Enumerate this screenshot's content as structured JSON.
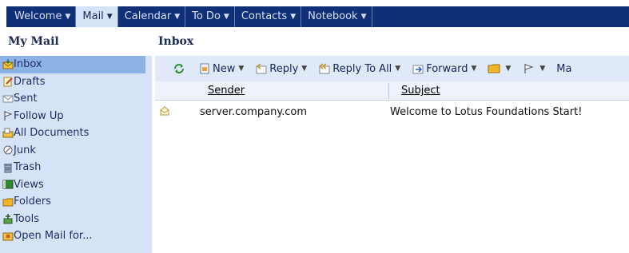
{
  "tabs": [
    {
      "label": "Welcome",
      "active": false
    },
    {
      "label": "Mail",
      "active": true
    },
    {
      "label": "Calendar",
      "active": false
    },
    {
      "label": "To Do",
      "active": false
    },
    {
      "label": "Contacts",
      "active": false
    },
    {
      "label": "Notebook",
      "active": false
    }
  ],
  "sidebar": {
    "title": "My Mail",
    "items": [
      {
        "label": "Inbox",
        "icon": "inbox-icon",
        "selected": true
      },
      {
        "label": "Drafts",
        "icon": "drafts-icon"
      },
      {
        "label": "Sent",
        "icon": "sent-icon"
      },
      {
        "label": "Follow Up",
        "icon": "follow-up-flag-icon"
      },
      {
        "label": "All Documents",
        "icon": "all-documents-icon"
      },
      {
        "label": "Junk",
        "icon": "junk-icon"
      },
      {
        "label": "Trash",
        "icon": "trash-icon"
      },
      {
        "label": "Views",
        "icon": "views-icon"
      },
      {
        "label": "Folders",
        "icon": "folders-icon"
      },
      {
        "label": "Tools",
        "icon": "tools-icon"
      },
      {
        "label": "Open Mail for...",
        "icon": "open-mail-icon"
      }
    ]
  },
  "main": {
    "title": "Inbox",
    "toolbar": {
      "refresh_icon": "refresh-icon",
      "new_label": "New",
      "reply_label": "Reply",
      "reply_all_label": "Reply To All",
      "forward_label": "Forward",
      "overflow_label": "Ma"
    },
    "columns": {
      "sender": "Sender",
      "subject": "Subject"
    },
    "rows": [
      {
        "sender": "server.company.com",
        "subject": "Welcome to Lotus Foundations Start!"
      }
    ]
  },
  "colors": {
    "tabbar_bg": "#0f2f77",
    "active_tab_bg": "#d6e3f6",
    "sidebar_bg": "#d6e3f6",
    "selected_item_bg": "#8fb2e6",
    "toolbar_bg": "#dfe9f7"
  }
}
